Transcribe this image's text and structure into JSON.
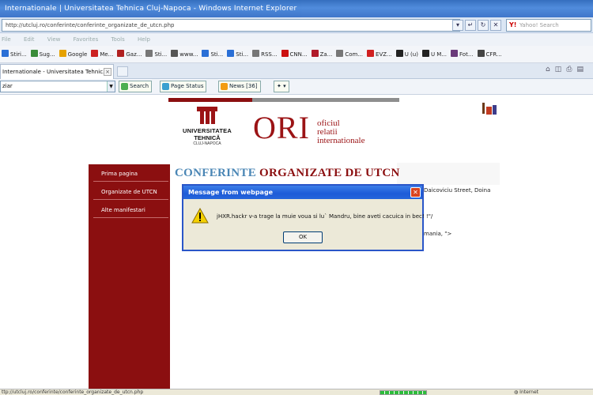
{
  "window": {
    "title": "Internationale | Universitatea Tehnica Cluj-Napoca - Windows Internet Explorer"
  },
  "address": {
    "url": "http://utcluj.ro/conferinte/conferinte_organizate_de_utcn.php",
    "search_placeholder": "Yahoo! Search"
  },
  "menu": [
    "File",
    "Edit",
    "View",
    "Favorites",
    "Tools",
    "Help"
  ],
  "favorites": [
    {
      "label": "Stiri...",
      "color": "#2a6fd6"
    },
    {
      "label": "Sug...",
      "color": "#3a8c3a"
    },
    {
      "label": "Google",
      "color": "#e6a200"
    },
    {
      "label": "Me...",
      "color": "#cc2222"
    },
    {
      "label": "Gaz...",
      "color": "#b02020"
    },
    {
      "label": "Sti...",
      "color": "#777777"
    },
    {
      "label": "www...",
      "color": "#555555"
    },
    {
      "label": "Sti...",
      "color": "#2a6fd6"
    },
    {
      "label": "Sti...",
      "color": "#2a6fd6"
    },
    {
      "label": "RSS...",
      "color": "#777777"
    },
    {
      "label": "CNN...",
      "color": "#cc1111"
    },
    {
      "label": "Za...",
      "color": "#b01a2a"
    },
    {
      "label": "Com...",
      "color": "#777777"
    },
    {
      "label": "EVZ...",
      "color": "#d02020"
    },
    {
      "label": "U (u)",
      "color": "#222222"
    },
    {
      "label": "U M...",
      "color": "#222222"
    },
    {
      "label": "Fot...",
      "color": "#6a3a7a"
    },
    {
      "label": "CFR...",
      "color": "#444444"
    }
  ],
  "tab": {
    "label": "Internationale - Universitatea Tehnic..."
  },
  "toolbar2": {
    "search_value": "ziar",
    "search_label": "Search",
    "page_status_label": "Page Status",
    "news_label": "News [36]"
  },
  "site": {
    "university_line1": "UNIVERSITATEA",
    "university_line2": "TEHNICĂ",
    "university_line3": "CLUJ-NAPOCA",
    "ori_short": "ORI",
    "ori_line1": "oficiul",
    "ori_line2": "relatii",
    "ori_line3": "internationale",
    "sidebar": [
      "Prima pagina",
      "Organizate de UTCN",
      "Alte manifestari"
    ],
    "heading_part1": "CONFERINTE",
    "heading_part2": "ORGANIZATE DE UTCN",
    "text_behind_1": "Daicoviciu Street, Doina",
    "text_behind_2": "mania, \">"
  },
  "dialog": {
    "title": "Message from webpage",
    "message": "jHXR.hackr v-a trage la muie voua si lu` Mandru, bine aveti cacuica in bec! !\"/",
    "ok_label": "OK"
  },
  "status": {
    "text": "ttp://utcluj.ro/conferinte/conferinte_organizate_de_utcn.php",
    "zone": "Internet"
  }
}
